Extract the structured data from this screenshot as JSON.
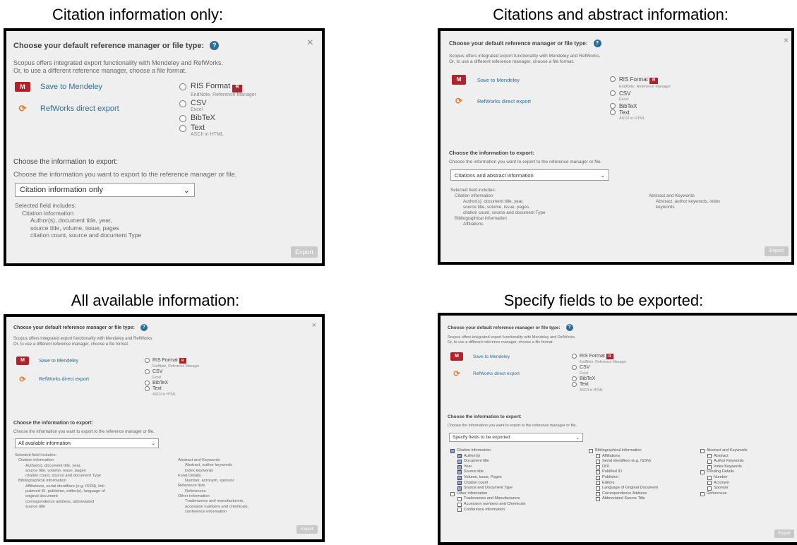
{
  "captions": {
    "citation_only": "Citation information only:",
    "citations_abstract": "Citations and abstract information:",
    "all_available": "All available information:",
    "specify_fields": "Specify fields to be exported:"
  },
  "dialog": {
    "title": "Choose your default reference manager or file type:",
    "help_glyph": "?",
    "close_glyph": "×",
    "intro": "Scopus offers integrated export functionality with Mendeley and RefWorks.",
    "intro2": "Or, to use a different reference manager, choose a file format.",
    "save_mendeley": "Save to Mendeley",
    "refworks_export": "RefWorks direct export",
    "formats": [
      {
        "name": "RIS Format",
        "sub": "EndNote, Reference Manager"
      },
      {
        "name": "CSV",
        "sub": "Excel"
      },
      {
        "name": "BibTeX",
        "sub": ""
      },
      {
        "name": "Text",
        "sub": "ASCII in HTML"
      }
    ],
    "choose_info_title": "Choose the information to export:",
    "choose_info_desc": "Choose the information you want to export to the reference manager or file.",
    "export_label": "Export",
    "dropdown_arrow": "⌄"
  },
  "panel1": {
    "select_value": "Citation information only",
    "selected_fields_label": "Selected field includes:",
    "lines": [
      "Citation information",
      "Author(s), document title, year,",
      "source title, volume, issue, pages",
      "citation count, source and document Type"
    ]
  },
  "panel2": {
    "select_value": "Citations and abstract information",
    "selected_fields_label": "Selected field includes:",
    "left_lines": [
      "Citation information",
      "Author(s), document title, year,",
      "source title, volume, issue, pages",
      "citation count, source and document Type",
      "Bibliographical information",
      "Affiliations"
    ],
    "right_lines": [
      "Abstract and Keywords",
      "Abstract, author keywords, index",
      "keywords"
    ]
  },
  "panel3": {
    "select_value": "All available information",
    "selected_fields_label": "Selected field includes:",
    "left_lines": [
      "Citation information",
      "Author(s), document title, year,",
      "source title, volume, issue, pages",
      "citation count, source and document Type",
      "Bibliographical information",
      "Affiliations, serial identifiers (e.g. ISSN), link",
      "pubmed ID, publisher, editor(s), language of",
      "original document",
      "correspondence address, abbreviated",
      "source title"
    ],
    "right_lines": [
      "Abstract and Keywords",
      "Abstract, author keywords",
      "index keywords",
      "Fund Details",
      "Number, acronym, sponsor",
      "Reference lists",
      "References",
      "Other information",
      "Tradenames and manufacturers,",
      "accession numbers and chemicals,",
      "conference information"
    ]
  },
  "panel4": {
    "select_value": "Specify fields to be exported",
    "col1": [
      {
        "label": "Citation information",
        "checked": true,
        "indent": 0
      },
      {
        "label": "Author(s)",
        "checked": true,
        "indent": 1
      },
      {
        "label": "Document title",
        "checked": true,
        "indent": 1
      },
      {
        "label": "Year",
        "checked": true,
        "indent": 1
      },
      {
        "label": "Source title",
        "checked": true,
        "indent": 1
      },
      {
        "label": "Volume, issue, Pages",
        "checked": true,
        "indent": 1
      },
      {
        "label": "Citation count",
        "checked": true,
        "indent": 1
      },
      {
        "label": "Source and Document Type",
        "checked": true,
        "indent": 1
      },
      {
        "label": "Other information",
        "checked": false,
        "indent": 0
      },
      {
        "label": "Tradenames and Manufacturers",
        "checked": false,
        "indent": 1
      },
      {
        "label": "Accession numbers and Chemicals",
        "checked": false,
        "indent": 1
      },
      {
        "label": "Conference information",
        "checked": false,
        "indent": 1
      }
    ],
    "col2": [
      {
        "label": "Bibliographical information",
        "checked": false,
        "indent": 0
      },
      {
        "label": "Affiliations",
        "checked": false,
        "indent": 1
      },
      {
        "label": "Serial identifiers (e.g. ISSN)",
        "checked": false,
        "indent": 1
      },
      {
        "label": "DOI",
        "checked": false,
        "indent": 1
      },
      {
        "label": "PubMed ID",
        "checked": false,
        "indent": 1
      },
      {
        "label": "Publisher",
        "checked": false,
        "indent": 1
      },
      {
        "label": "Editors",
        "checked": false,
        "indent": 1
      },
      {
        "label": "Language of Original Document",
        "checked": false,
        "indent": 1
      },
      {
        "label": "Correspondence Address",
        "checked": false,
        "indent": 1
      },
      {
        "label": "Abbreviated Source Title",
        "checked": false,
        "indent": 1
      }
    ],
    "col3": [
      {
        "label": "Abstract and Keywords",
        "checked": false,
        "indent": 0
      },
      {
        "label": "Abstract",
        "checked": false,
        "indent": 1
      },
      {
        "label": "Author Keywords",
        "checked": false,
        "indent": 1
      },
      {
        "label": "Index Keywords",
        "checked": false,
        "indent": 1
      },
      {
        "label": "Funding Details",
        "checked": false,
        "indent": 0
      },
      {
        "label": "Number",
        "checked": false,
        "indent": 1
      },
      {
        "label": "Acronym",
        "checked": false,
        "indent": 1
      },
      {
        "label": "Sponsor",
        "checked": false,
        "indent": 1
      },
      {
        "label": "References",
        "checked": false,
        "indent": 0
      }
    ]
  }
}
